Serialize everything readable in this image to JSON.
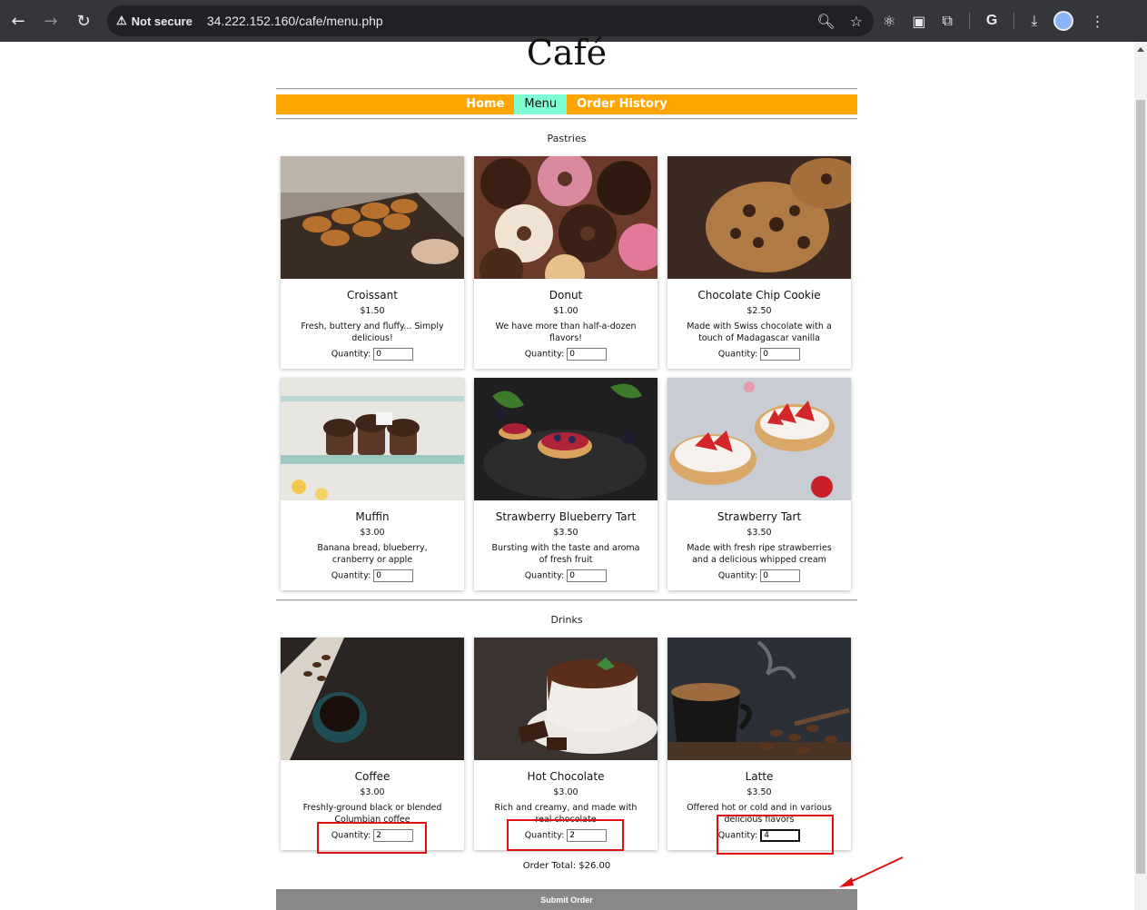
{
  "browser": {
    "security_label": "Not secure",
    "url": "34.222.152.160/cafe/menu.php"
  },
  "site": {
    "title": "Café",
    "nav": [
      {
        "label": "Home",
        "active": false
      },
      {
        "label": "Menu",
        "active": true
      },
      {
        "label": "Order History",
        "active": false
      }
    ]
  },
  "sections": {
    "pastries": {
      "title": "Pastries",
      "items": [
        {
          "name": "Croissant",
          "price": "$1.50",
          "desc": "Fresh, buttery and fluffy... Simply delicious!",
          "qty_label": "Quantity:",
          "qty": "0"
        },
        {
          "name": "Donut",
          "price": "$1.00",
          "desc": "We have more than half-a-dozen flavors!",
          "qty_label": "Quantity:",
          "qty": "0"
        },
        {
          "name": "Chocolate Chip Cookie",
          "price": "$2.50",
          "desc": "Made with Swiss chocolate with a touch of Madagascar vanilla",
          "qty_label": "Quantity:",
          "qty": "0"
        },
        {
          "name": "Muffin",
          "price": "$3.00",
          "desc": "Banana bread, blueberry, cranberry or apple",
          "qty_label": "Quantity:",
          "qty": "0"
        },
        {
          "name": "Strawberry Blueberry Tart",
          "price": "$3.50",
          "desc": "Bursting with the taste and aroma of fresh fruit",
          "qty_label": "Quantity:",
          "qty": "0"
        },
        {
          "name": "Strawberry Tart",
          "price": "$3.50",
          "desc": "Made with fresh ripe strawberries and a delicious whipped cream",
          "qty_label": "Quantity:",
          "qty": "0"
        }
      ]
    },
    "drinks": {
      "title": "Drinks",
      "items": [
        {
          "name": "Coffee",
          "price": "$3.00",
          "desc": "Freshly-ground black or blended Columbian coffee",
          "qty_label": "Quantity:",
          "qty": "2"
        },
        {
          "name": "Hot Chocolate",
          "price": "$3.00",
          "desc": "Rich and creamy, and made with real chocolate",
          "qty_label": "Quantity:",
          "qty": "2"
        },
        {
          "name": "Latte",
          "price": "$3.50",
          "desc": "Offered hot or cold and in various delicious flavors",
          "qty_label": "Quantity:",
          "qty": "4"
        }
      ]
    }
  },
  "order": {
    "total_text": "Order Total: $26.00",
    "submit_label": "Submit Order"
  },
  "colors": {
    "menubar": "#ffa500",
    "nav_active": "#7fffd4",
    "submit": "#888888",
    "annotation": "#e01010"
  }
}
